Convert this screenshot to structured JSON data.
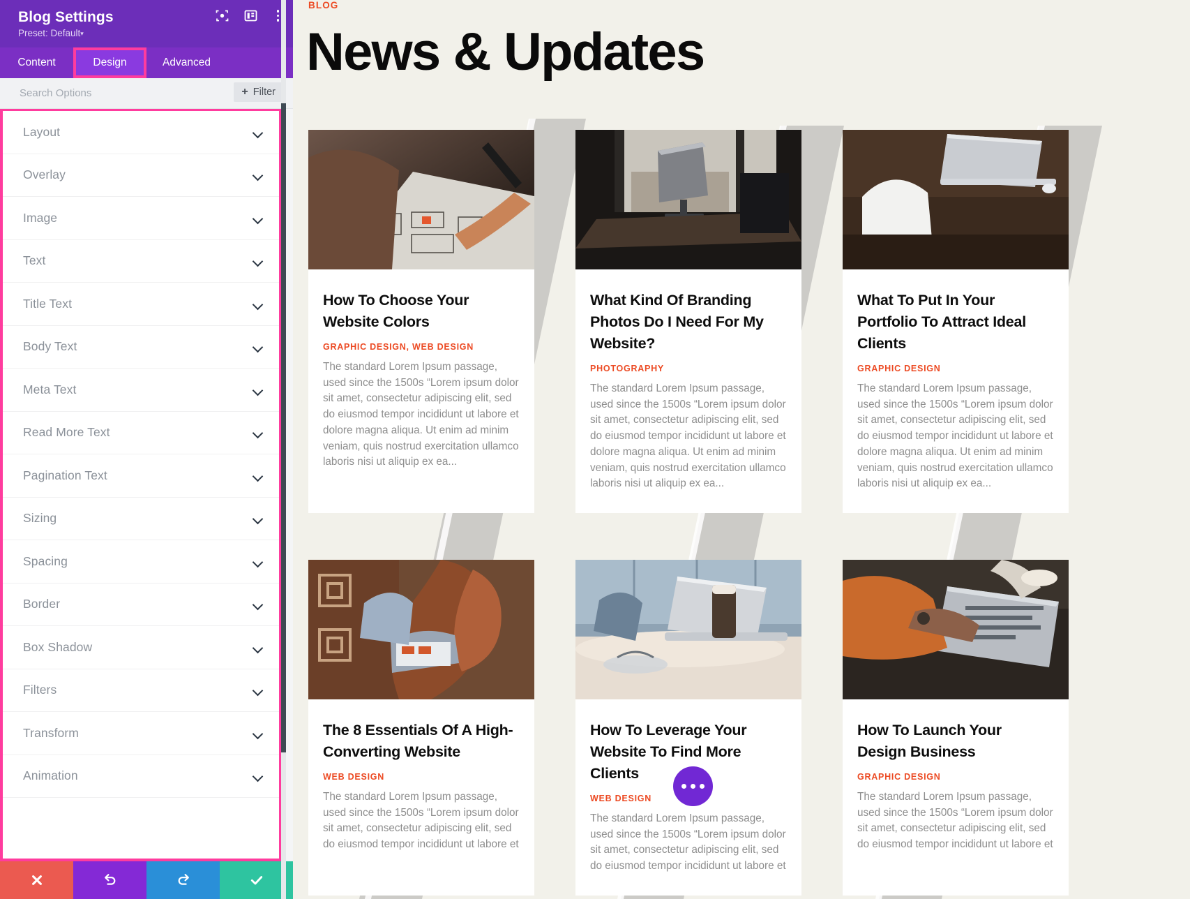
{
  "settings_panel": {
    "title": "Blog Settings",
    "preset_label": "Preset: Default",
    "preset_caret": "▾",
    "header_icons": [
      {
        "name": "focus-icon",
        "glyph": "focus"
      },
      {
        "name": "panel-layout-icon",
        "glyph": "panel"
      },
      {
        "name": "more-vertical-icon",
        "glyph": "dots"
      }
    ],
    "tabs": [
      {
        "label": "Content",
        "active": false
      },
      {
        "label": "Design",
        "active": true
      },
      {
        "label": "Advanced",
        "active": false
      }
    ],
    "search": {
      "placeholder": "Search Options",
      "value": ""
    },
    "filter_button": {
      "label": "Filter",
      "icon": "plus-icon"
    },
    "option_groups": [
      {
        "label": "Layout"
      },
      {
        "label": "Overlay"
      },
      {
        "label": "Image"
      },
      {
        "label": "Text"
      },
      {
        "label": "Title Text"
      },
      {
        "label": "Body Text"
      },
      {
        "label": "Meta Text"
      },
      {
        "label": "Read More Text"
      },
      {
        "label": "Pagination Text"
      },
      {
        "label": "Sizing"
      },
      {
        "label": "Spacing"
      },
      {
        "label": "Border"
      },
      {
        "label": "Box Shadow"
      },
      {
        "label": "Filters"
      },
      {
        "label": "Transform"
      },
      {
        "label": "Animation"
      }
    ],
    "action_buttons": [
      {
        "name": "discard-button",
        "icon": "close-icon",
        "color": "#eb5a50"
      },
      {
        "name": "undo-button",
        "icon": "undo-icon",
        "color": "#8429d6"
      },
      {
        "name": "redo-button",
        "icon": "redo-icon",
        "color": "#2a8fd8"
      },
      {
        "name": "save-button",
        "icon": "check-icon",
        "color": "#2ec4a0"
      }
    ],
    "highlight_color": "#ff3c9e",
    "header_color": "#6c2eb9",
    "tabbar_color": "#7b2fc4"
  },
  "preview": {
    "eyebrow": "BLOG",
    "heading": "News & Updates",
    "background_color": "#f2f1ea",
    "accent_color": "#ec4a23",
    "fab": {
      "name": "options-fab",
      "color": "#7128d4",
      "icon": "three-dots-icon"
    },
    "excerpt_common": "The standard Lorem Ipsum passage, used since the 1500s “Lorem ipsum dolor sit amet, consectetur adipiscing elit, sed do eiusmod tempor incididunt ut labore et dolore magna aliqua. Ut enim ad minim veniam, quis nostrud exercitation ullamco laboris nisi ut aliquip ex ea...",
    "posts": [
      {
        "title": "How To Choose Your Website Colors",
        "category": "GRAPHIC DESIGN, WEB DESIGN",
        "excerpt": "The standard Lorem Ipsum passage, used since the 1500s “Lorem ipsum dolor sit amet, consectetur adipiscing elit, sed do eiusmod tempor incididunt ut labore et dolore magna aliqua. Ut enim ad minim veniam, quis nostrud exercitation ullamco laboris nisi ut aliquip ex ea...",
        "image": "hands-sketching-wireframe"
      },
      {
        "title": "What Kind Of Branding Photos Do I Need For My Website?",
        "category": "PHOTOGRAPHY",
        "excerpt": "The standard Lorem Ipsum passage, used since the 1500s “Lorem ipsum dolor sit amet, consectetur adipiscing elit, sed do eiusmod tempor incididunt ut labore et dolore magna aliqua. Ut enim ad minim veniam, quis nostrud exercitation ullamco laboris nisi ut aliquip ex ea...",
        "image": "imac-desk-by-window"
      },
      {
        "title": "What To Put In Your Portfolio To Attract Ideal Clients",
        "category": "GRAPHIC DESIGN",
        "excerpt": "The standard Lorem Ipsum passage, used since the 1500s “Lorem ipsum dolor sit amet, consectetur adipiscing elit, sed do eiusmod tempor incididunt ut labore et dolore magna aliqua. Ut enim ad minim veniam, quis nostrud exercitation ullamco laboris nisi ut aliquip ex ea...",
        "image": "laptop-white-chair-desk"
      },
      {
        "title": "The 8 Essentials Of A High-Converting Website",
        "category": "WEB DESIGN",
        "excerpt": "The standard Lorem Ipsum passage, used since the 1500s “Lorem ipsum dolor sit amet, consectetur adipiscing elit, sed do eiusmod tempor incididunt ut labore et",
        "image": "woman-on-rug-with-laptop"
      },
      {
        "title": "How To Leverage Your Website To Find More Clients",
        "category": "WEB DESIGN",
        "excerpt": "The standard Lorem Ipsum passage, used since the 1500s “Lorem ipsum dolor sit amet, consectetur adipiscing elit, sed do eiusmod tempor incididunt ut labore et",
        "image": "laptop-coffee-cafe-table"
      },
      {
        "title": "How To Launch Your Design Business",
        "category": "GRAPHIC DESIGN",
        "excerpt": "The standard Lorem Ipsum passage, used since the 1500s “Lorem ipsum dolor sit amet, consectetur adipiscing elit, sed do eiusmod tempor incididunt ut labore et",
        "image": "person-orange-sweater-laptop"
      }
    ]
  }
}
